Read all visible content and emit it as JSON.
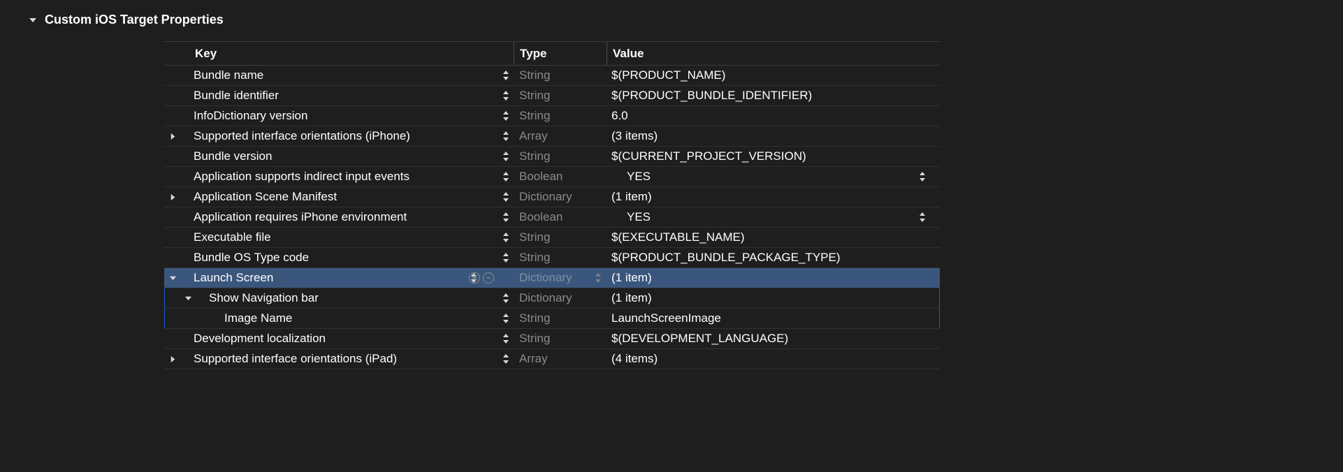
{
  "section": {
    "title": "Custom iOS Target Properties"
  },
  "columns": {
    "key": "Key",
    "type": "Type",
    "value": "Value"
  },
  "rows": [
    {
      "indent": 0,
      "disclosure": "none",
      "key": "Bundle name",
      "type": "String",
      "value": "$(PRODUCT_NAME)",
      "valueStepper": false
    },
    {
      "indent": 0,
      "disclosure": "none",
      "key": "Bundle identifier",
      "type": "String",
      "value": "$(PRODUCT_BUNDLE_IDENTIFIER)",
      "valueStepper": false
    },
    {
      "indent": 0,
      "disclosure": "none",
      "key": "InfoDictionary version",
      "type": "String",
      "value": "6.0",
      "valueStepper": false
    },
    {
      "indent": 0,
      "disclosure": "right",
      "key": "Supported interface orientations (iPhone)",
      "type": "Array",
      "value": "(3 items)",
      "valueStepper": false
    },
    {
      "indent": 0,
      "disclosure": "none",
      "key": "Bundle version",
      "type": "String",
      "value": "$(CURRENT_PROJECT_VERSION)",
      "valueStepper": false
    },
    {
      "indent": 0,
      "disclosure": "none",
      "key": "Application supports indirect input events",
      "type": "Boolean",
      "value": "YES",
      "valueStepper": true,
      "boolPad": true
    },
    {
      "indent": 0,
      "disclosure": "right",
      "key": "Application Scene Manifest",
      "type": "Dictionary",
      "value": "(1 item)",
      "valueStepper": false
    },
    {
      "indent": 0,
      "disclosure": "none",
      "key": "Application requires iPhone environment",
      "type": "Boolean",
      "value": "YES",
      "valueStepper": true,
      "boolPad": true
    },
    {
      "indent": 0,
      "disclosure": "none",
      "key": "Executable file",
      "type": "String",
      "value": "$(EXECUTABLE_NAME)",
      "valueStepper": false
    },
    {
      "indent": 0,
      "disclosure": "none",
      "key": "Bundle OS Type code",
      "type": "String",
      "value": "$(PRODUCT_BUNDLE_PACKAGE_TYPE)",
      "valueStepper": false
    },
    {
      "indent": 0,
      "disclosure": "down",
      "key": "Launch Screen",
      "type": "Dictionary",
      "value": "(1 item)",
      "valueStepper": false,
      "selected": true,
      "actions": true,
      "typeStepper": true,
      "dimTypeStepper": true
    },
    {
      "indent": 1,
      "disclosure": "down",
      "key": "Show Navigation bar",
      "type": "Dictionary",
      "value": "(1 item)",
      "valueStepper": false,
      "inGroup": true
    },
    {
      "indent": 2,
      "disclosure": "none",
      "key": "Image Name",
      "type": "String",
      "value": "LaunchScreenImage",
      "valueStepper": false,
      "inGroup": true
    },
    {
      "indent": 0,
      "disclosure": "none",
      "key": "Development localization",
      "type": "String",
      "value": "$(DEVELOPMENT_LANGUAGE)",
      "valueStepper": false
    },
    {
      "indent": 0,
      "disclosure": "right",
      "key": "Supported interface orientations (iPad)",
      "type": "Array",
      "value": "(4 items)",
      "valueStepper": false
    }
  ]
}
